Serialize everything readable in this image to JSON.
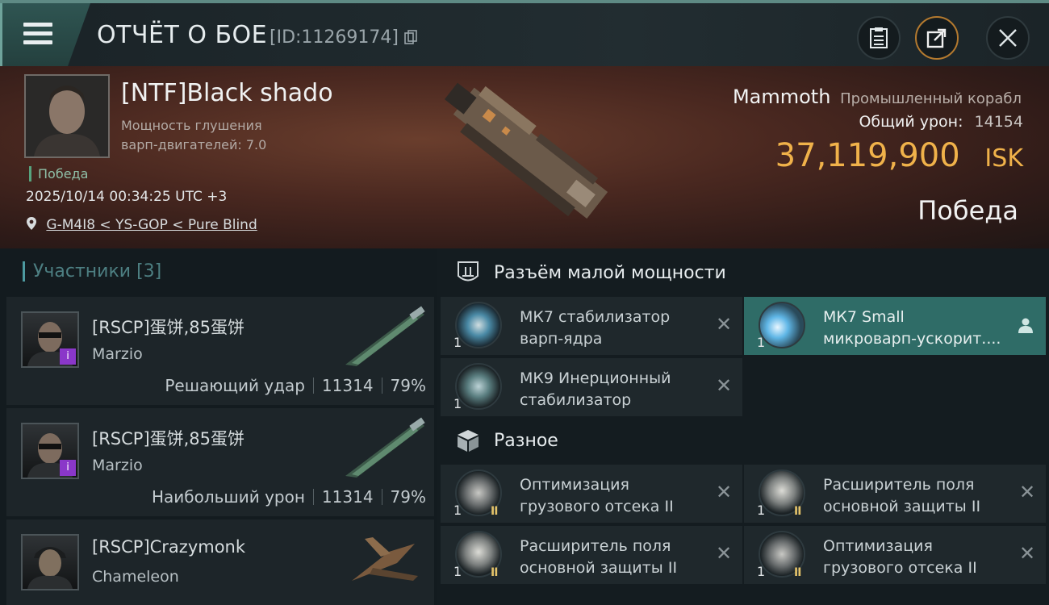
{
  "header": {
    "title": "ОТЧЁТ О БОЕ",
    "report_id": "[ID:11269174]"
  },
  "victim": {
    "pilot_name": "[NTF]Black shado",
    "attribute_line1": "Мощность глушения",
    "attribute_line2": "варп-двигателей: 7.0",
    "status_tag": "Победа",
    "datetime": "2025/10/14 00:34:25 UTC +3",
    "location": "G-M4I8 < YS-GOP < Pure Blind",
    "ship_name": "Mammoth",
    "ship_type": "Промышленный корабл",
    "damage_label": "Общий урон:",
    "damage_value": "14154",
    "isk_value": "37,119,900",
    "isk_unit": "ISK",
    "result": "Победа"
  },
  "participants": {
    "title": "Участники",
    "count": "[3]",
    "list": [
      {
        "name": "[RSCP]蛋饼,85蛋饼",
        "ship": "Marzio",
        "role": "Решающий удар",
        "damage": "11314",
        "percent": "79%",
        "badge": "i"
      },
      {
        "name": "[RSCP]蛋饼,85蛋饼",
        "ship": "Marzio",
        "role": "Наибольший урон",
        "damage": "11314",
        "percent": "79%",
        "badge": "i"
      },
      {
        "name": "[RSCP]Crazymonk",
        "ship": "Chameleon"
      }
    ]
  },
  "fittings": {
    "low_slot_title": "Разъём малой мощности",
    "misc_title": "Разное",
    "low_slots": [
      {
        "line1": "МК7 стабилизатор",
        "line2": "варп-ядра",
        "qty": "1"
      },
      {
        "line1": "МК7 Small",
        "line2": "микроварп-ускорит....",
        "qty": "1"
      },
      {
        "line1": "МК9 Инерционный",
        "line2": "стабилизатор",
        "qty": "1"
      }
    ],
    "misc_slots": [
      {
        "line1": "Оптимизация",
        "line2": "грузового отсека II",
        "qty": "1"
      },
      {
        "line1": "Расширитель поля",
        "line2": "основной защиты II",
        "qty": "1"
      },
      {
        "line1": "Расширитель поля",
        "line2": "основной защиты II",
        "qty": "1"
      },
      {
        "line1": "Оптимизация",
        "line2": "грузового отсека II",
        "qty": "1"
      }
    ]
  },
  "icons": [
    "menu-icon",
    "clipboard-icon",
    "share-icon",
    "close-icon",
    "location-pin-icon",
    "shield-slot-icon",
    "cube-icon",
    "user-icon",
    "remove-icon"
  ],
  "colors": {
    "isk": "#f0b24a",
    "accent": "#4d9aa0",
    "active_slot": "#2f6c67",
    "victory": "#57a37e"
  }
}
